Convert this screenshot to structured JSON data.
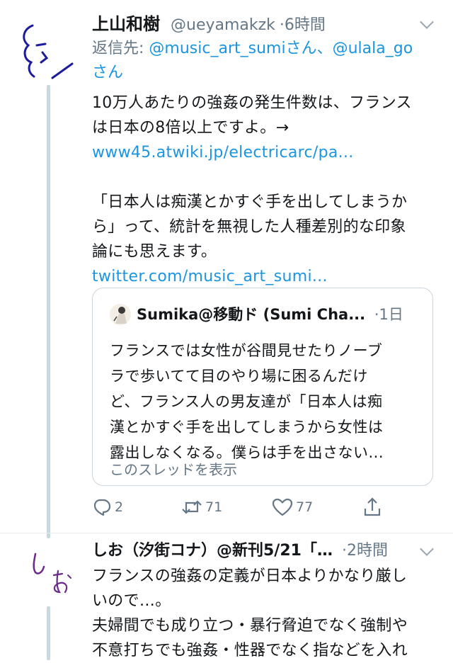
{
  "tweet1": {
    "name": "上山和樹",
    "handle": "@ueyamakzk",
    "time": "·6時間",
    "reply_prefix": "返信先:",
    "reply_mention1": "@music_art_sumiさん",
    "reply_separator": "、",
    "reply_mention2": "@ulala_go",
    "reply_suffix": "さん",
    "line1": "10万人あたりの強姦の発生件数は、フランス",
    "line2": "は日本の8倍以上ですよ。→",
    "link1": "www45.atwiki.jp/electricarc/pa...",
    "line3": "「日本人は痴漢とかすぐ手を出してしまうか",
    "line4": "ら」って、統計を無視した人種差別的な印象",
    "line5": "論にも思えます。",
    "link2": "twitter.com/music_art_sumi..."
  },
  "quote": {
    "name": "Sumika@移動ド (Sumi Cha...",
    "time": "·1日",
    "lines": [
      "フランスでは女性が谷間見せたりノーブ",
      "ラで歩いてて目のやり場に困るんだけ",
      "ど、フランス人の男友達が「日本人は痴",
      "漢とかすぐ手を出してしまうから女性は",
      "露出しなくなる。僕らは手を出さない..."
    ],
    "show_thread": "このスレッドを表示"
  },
  "actions": {
    "reply_count": "2",
    "retweet_count": "71",
    "like_count": "77"
  },
  "tweet2": {
    "name": "しお（汐街コナ）@新刊5/21「…",
    "time": "·2時間",
    "line1": "フランスの強姦の定義が日本よりかなり厳し",
    "line2": "いので…。",
    "line3": "夫婦間でも成り立つ・暴行脅迫でなく強制や",
    "line4": "不意打ちでも強姦・性器でなく指などを入れ"
  },
  "colors": {
    "link": "#1b95e0",
    "secondary": "#657786",
    "thread_line": "#ccd6dd",
    "avatar_ink1": "#1c1c9c",
    "avatar_ink2": "#6a2a8a"
  },
  "icons": [
    "chevron-down-icon",
    "reply-icon",
    "retweet-icon",
    "like-icon",
    "share-icon"
  ]
}
